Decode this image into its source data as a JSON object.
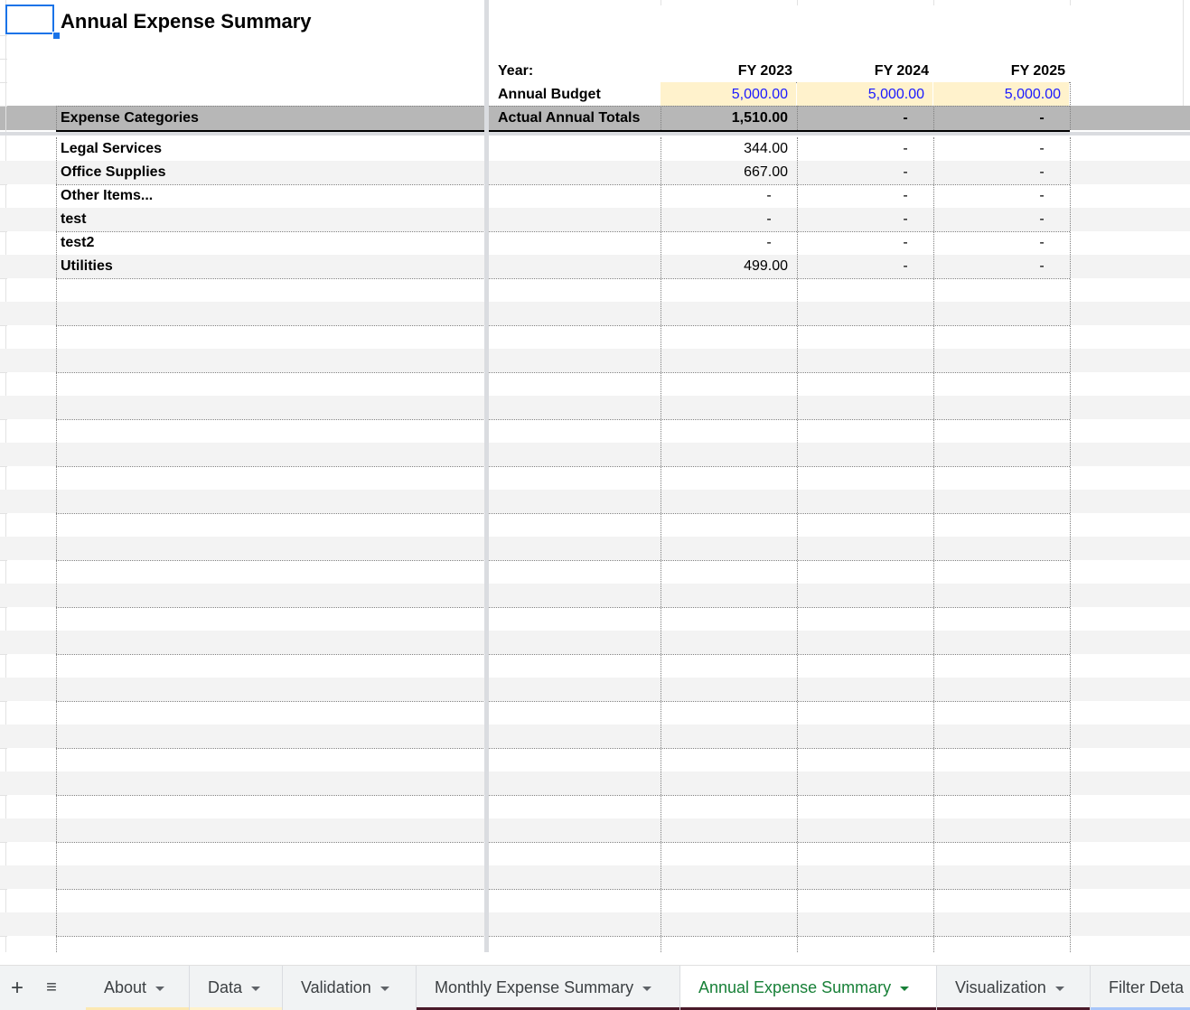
{
  "sheet": {
    "title": "Annual Expense Summary",
    "year_label": "Year:",
    "budget_label": "Annual Budget",
    "categories_header": "Expense Categories",
    "totals_label": "Actual Annual Totals",
    "years": [
      "FY 2023",
      "FY 2024",
      "FY 2025"
    ],
    "budgets": [
      "5,000.00",
      "5,000.00",
      "5,000.00"
    ],
    "totals": [
      "1,510.00",
      "-",
      "-"
    ],
    "rows": [
      {
        "category": "Legal Services",
        "values": [
          "344.00",
          "-",
          "-"
        ]
      },
      {
        "category": "Office Supplies",
        "values": [
          "667.00",
          "-",
          "-"
        ]
      },
      {
        "category": "Other Items...",
        "values": [
          "-",
          "-",
          "-"
        ]
      },
      {
        "category": "test",
        "values": [
          "-",
          "-",
          "-"
        ]
      },
      {
        "category": "test2",
        "values": [
          "-",
          "-",
          "-"
        ]
      },
      {
        "category": "Utilities",
        "values": [
          "499.00",
          "-",
          "-"
        ]
      }
    ]
  },
  "tabs": {
    "add_icon": "plus-icon",
    "list_icon": "menu-list-icon",
    "items": [
      {
        "label": "About",
        "underline": "#fce8b2"
      },
      {
        "label": "Data",
        "underline": "#fff2cc"
      },
      {
        "label": "Validation",
        "underline": ""
      },
      {
        "label": "Monthly Expense Summary",
        "underline": "#4a1a2a"
      },
      {
        "label": "Annual Expense Summary",
        "underline": "#4a1a2a"
      },
      {
        "label": "Visualization",
        "underline": "#4a1a2a"
      },
      {
        "label": "Filter Deta",
        "underline": "#a8c7fa"
      }
    ],
    "active_index": 4
  },
  "colors": {
    "budget_fill": "#fff2cc",
    "header_fill": "#b7b7b7",
    "stripe_fill": "#f3f3f3",
    "budget_text": "#1a1aff",
    "active_tab_text": "#188038"
  }
}
